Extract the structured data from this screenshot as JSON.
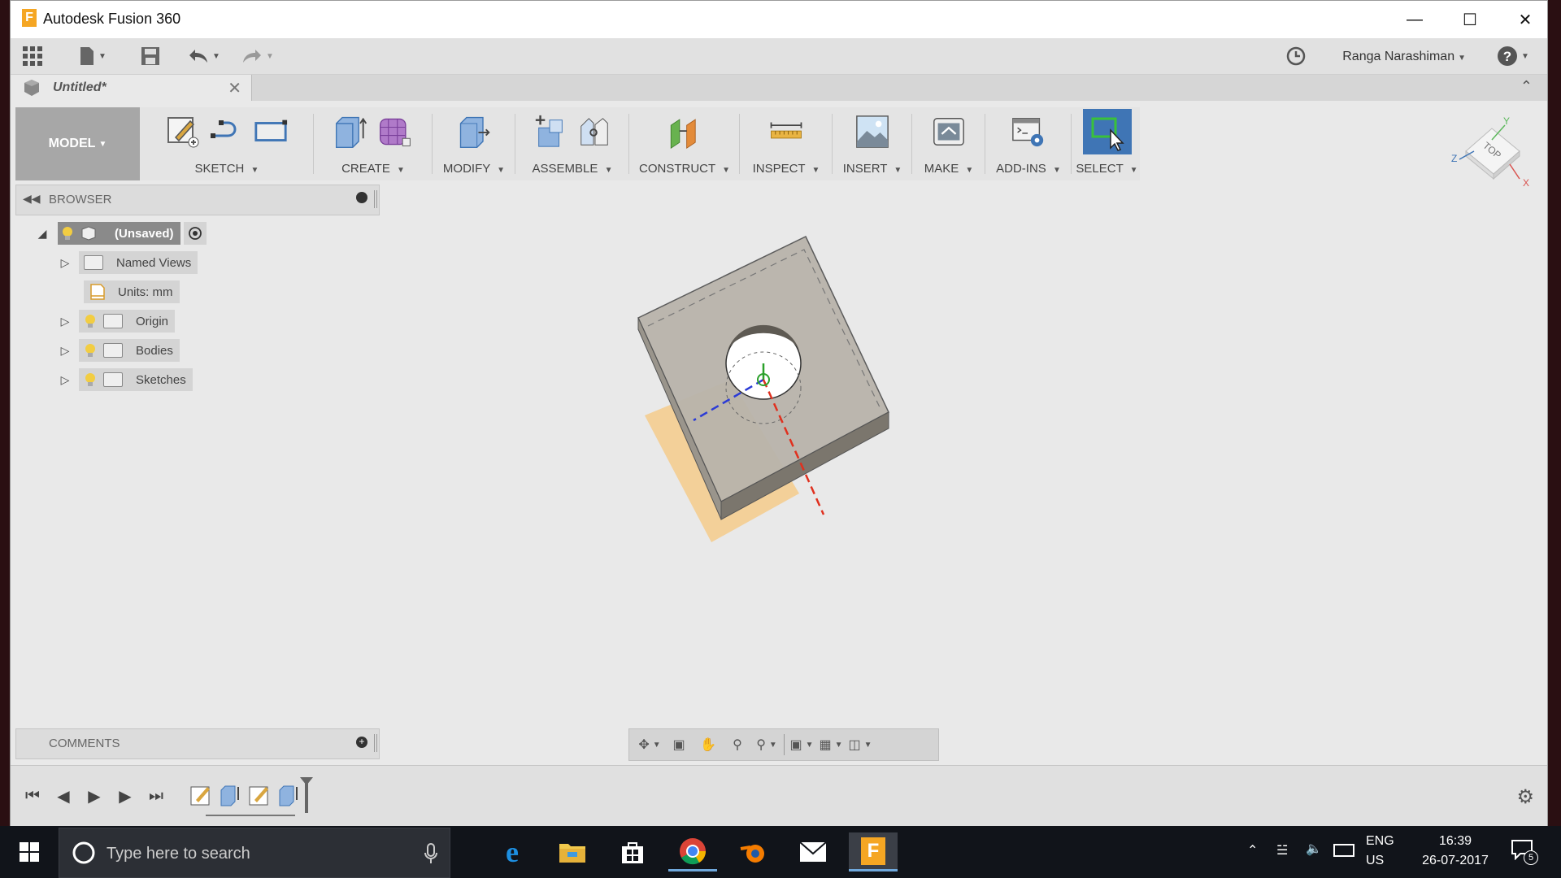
{
  "window": {
    "title": "Autodesk Fusion 360"
  },
  "quick_access": {
    "user_name": "Ranga Narashiman"
  },
  "tabs": {
    "document_title": "Untitled*"
  },
  "toolbar": {
    "workspace_label": "MODEL",
    "groups": [
      {
        "label": "SKETCH"
      },
      {
        "label": "CREATE"
      },
      {
        "label": "MODIFY"
      },
      {
        "label": "ASSEMBLE"
      },
      {
        "label": "CONSTRUCT"
      },
      {
        "label": "INSPECT"
      },
      {
        "label": "INSERT"
      },
      {
        "label": "MAKE"
      },
      {
        "label": "ADD-INS"
      },
      {
        "label": "SELECT"
      }
    ]
  },
  "browser": {
    "title": "BROWSER",
    "root": "(Unsaved)",
    "items": [
      {
        "label": "Named Views"
      },
      {
        "label": "Units: mm"
      },
      {
        "label": "Origin"
      },
      {
        "label": "Bodies"
      },
      {
        "label": "Sketches"
      }
    ]
  },
  "comments": {
    "title": "COMMENTS"
  },
  "viewcube": {
    "face_label": "TOP",
    "axis_x": "X",
    "axis_y": "Y",
    "axis_z": "Z"
  },
  "taskbar": {
    "search_placeholder": "Type here to search",
    "lang_top": "ENG",
    "lang_bottom": "US",
    "time": "16:39",
    "date": "26-07-2017",
    "notification_count": "5"
  },
  "colors": {
    "accent": "#3f75b5",
    "model_button": "#a7a7a7",
    "body_face": "#b9b4ab",
    "plane": "#f5c77e"
  }
}
